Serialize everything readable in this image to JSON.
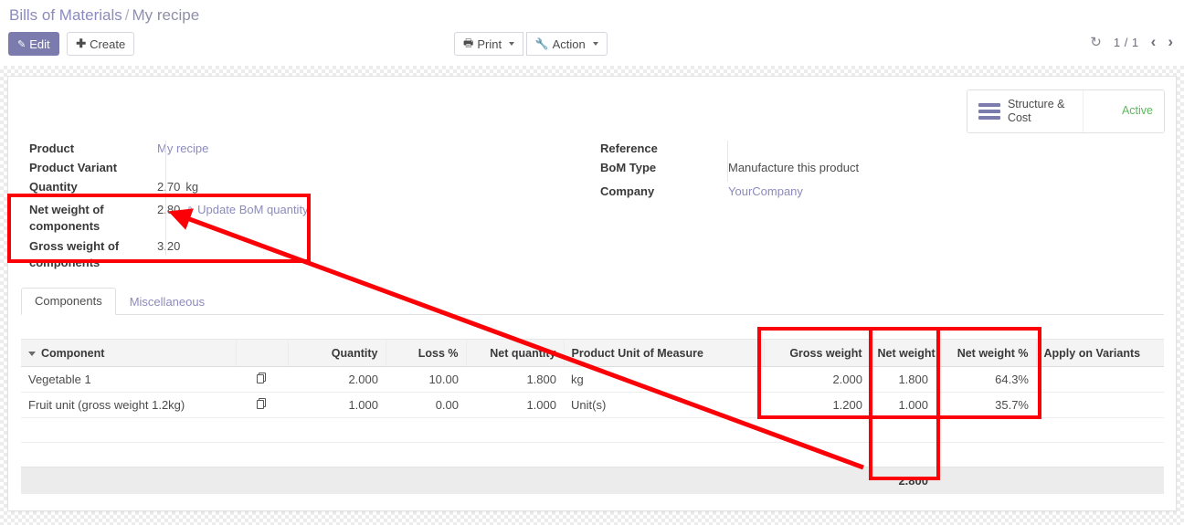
{
  "breadcrumb": {
    "parent": "Bills of Materials",
    "separator": "/",
    "current": "My recipe"
  },
  "toolbar": {
    "edit_label": "Edit",
    "create_label": "Create",
    "print_label": "Print",
    "action_label": "Action"
  },
  "pager": {
    "refresh_icon": "refresh-icon",
    "count": "1 / 1",
    "prev": "‹",
    "next": "›"
  },
  "stat_buttons": [
    {
      "icon": "list-bars-icon",
      "label": "Structure & Cost"
    },
    {
      "icon": "archive-box-icon",
      "label": "Active"
    }
  ],
  "form": {
    "left": [
      {
        "label": "Product",
        "value": "My recipe",
        "style": "link"
      },
      {
        "label": "Product Variant",
        "value": ""
      },
      {
        "label": "Quantity",
        "value": "2.70",
        "unit": "kg"
      },
      {
        "label": "Net weight of components",
        "value": "2.80",
        "action": "Update BoM quantity",
        "action_icon": "up-arrow-icon"
      },
      {
        "label": "Gross weight of components",
        "value": "3.20"
      }
    ],
    "right": [
      {
        "label": "Reference",
        "value": ""
      },
      {
        "label": "BoM Type",
        "value": "Manufacture this product"
      },
      {
        "label": "Company",
        "value": "YourCompany",
        "style": "link"
      }
    ]
  },
  "tabs": [
    {
      "label": "Components",
      "active": true
    },
    {
      "label": "Miscellaneous",
      "active": false
    }
  ],
  "table": {
    "columns": [
      "Component",
      "",
      "Quantity",
      "Loss %",
      "Net quantity",
      "Product Unit of Measure",
      "Gross weight",
      "Net weight",
      "Net weight %",
      "Apply on Variants"
    ],
    "rows": [
      {
        "component": "Vegetable 1",
        "copy_icon": "copy-icon",
        "quantity": "2.000",
        "loss": "10.00",
        "net_quantity": "1.800",
        "uom": "kg",
        "gross_weight": "2.000",
        "net_weight": "1.800",
        "net_weight_pct": "64.3%",
        "apply_on_variants": ""
      },
      {
        "component": "Fruit unit (gross weight 1.2kg)",
        "copy_icon": "copy-icon",
        "quantity": "1.000",
        "loss": "0.00",
        "net_quantity": "1.000",
        "uom": "Unit(s)",
        "gross_weight": "1.200",
        "net_weight": "1.000",
        "net_weight_pct": "35.7%",
        "apply_on_variants": ""
      }
    ],
    "footer": {
      "net_weight_total": "2.800"
    }
  },
  "annotations": {
    "color": "#fb0007",
    "boxes": [
      {
        "name": "net-weight-of-components-field"
      },
      {
        "name": "weight-columns-group"
      },
      {
        "name": "net-weight-column"
      }
    ],
    "arrow": {
      "from": "net-weight-total-cell",
      "to": "net-weight-of-components-value"
    }
  }
}
